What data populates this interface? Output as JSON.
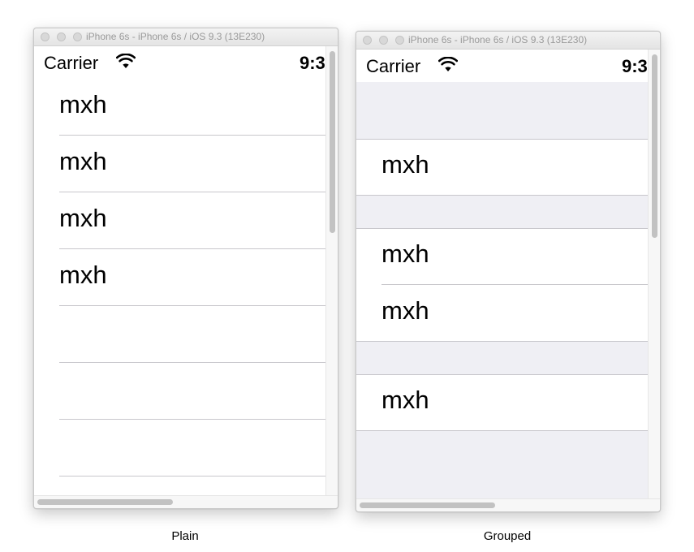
{
  "windows": {
    "plain": {
      "title": "iPhone 6s - iPhone 6s / iOS 9.3 (13E230)",
      "carrier": "Carrier",
      "time": "9:3",
      "rows": [
        "mxh",
        "mxh",
        "mxh",
        "mxh"
      ],
      "caption": "Plain"
    },
    "grouped": {
      "title": "iPhone 6s - iPhone 6s / iOS 9.3 (13E230)",
      "carrier": "Carrier",
      "time": "9:3",
      "rows": [
        "mxh",
        "mxh",
        "mxh",
        "mxh"
      ],
      "caption": "Grouped"
    }
  },
  "icons": {
    "window_controls": [
      "close-icon",
      "minimize-icon",
      "zoom-icon"
    ],
    "status": "wifi-icon"
  },
  "colors": {
    "separator": "#c8c7cc",
    "grouped_background": "#efeff4",
    "text": "#000000"
  }
}
